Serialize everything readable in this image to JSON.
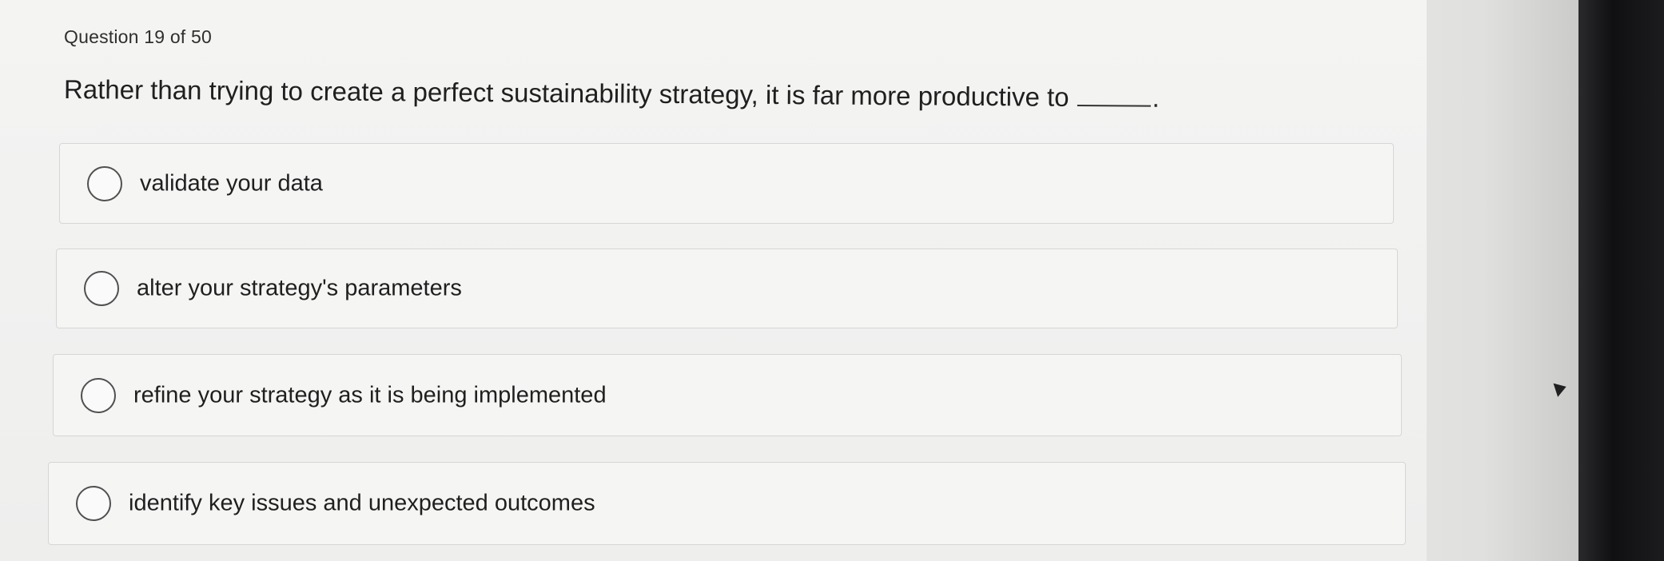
{
  "quiz": {
    "counter": "Question 19 of 50",
    "question_text": "Rather than trying to create a perfect sustainability strategy, it is far more productive to",
    "question_end": ".",
    "options": [
      {
        "label": "validate your data"
      },
      {
        "label": "alter your strategy's parameters"
      },
      {
        "label": "refine your strategy as it is being implemented"
      },
      {
        "label": "identify key issues and unexpected outcomes"
      }
    ]
  }
}
